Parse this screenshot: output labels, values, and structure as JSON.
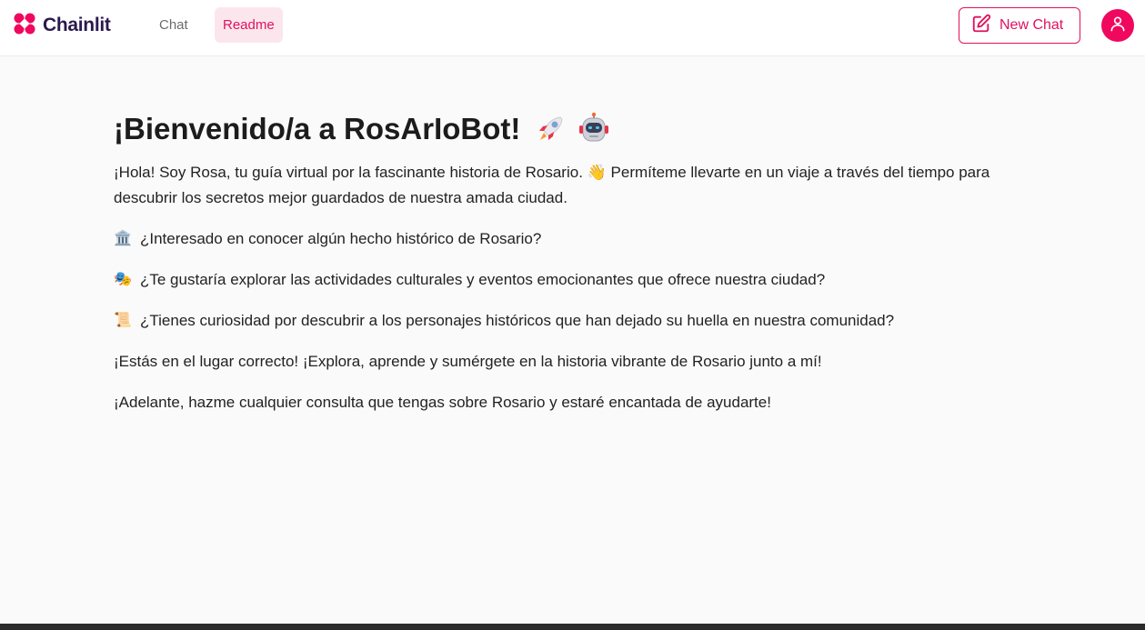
{
  "brand": {
    "name": "Chainlit",
    "accent_color": "#e0115f",
    "logo_icon": "chainlit-logo-icon"
  },
  "nav": {
    "tabs": [
      {
        "label": "Chat",
        "active": false
      },
      {
        "label": "Readme",
        "active": true
      }
    ]
  },
  "header_actions": {
    "new_chat_label": "New Chat",
    "new_chat_icon": "edit-icon",
    "avatar_icon": "user-icon"
  },
  "readme": {
    "title": "¡Bienvenido/a a RosArIoBot! 🚀 🤖",
    "title_text": "¡Bienvenido/a a RosArIoBot!",
    "intro": "¡Hola! Soy Rosa, tu guía virtual por la fascinante historia de Rosario. 👋 Permíteme llevarte en un viaje a través del tiempo para descubrir los secretos mejor guardados de nuestra amada ciudad.",
    "items": [
      {
        "icon": "🏛️",
        "icon_name": "classical-building-icon",
        "text": "¿Interesado en conocer algún hecho histórico de Rosario?"
      },
      {
        "icon": "🎭",
        "icon_name": "performing-arts-icon",
        "text": "¿Te gustaría explorar las actividades culturales y eventos emocionantes que ofrece nuestra ciudad?"
      },
      {
        "icon": "📜",
        "icon_name": "scroll-icon",
        "text": "¿Tienes curiosidad por descubrir a los personajes históricos que han dejado su huella en nuestra comunidad?"
      }
    ],
    "closing_1": "¡Estás en el lugar correcto! ¡Explora, aprende y sumérgete en la historia vibrante de Rosario junto a mí!",
    "closing_2": "¡Adelante, hazme cualquier consulta que tengas sobre Rosario y estaré encantada de ayudarte!"
  }
}
